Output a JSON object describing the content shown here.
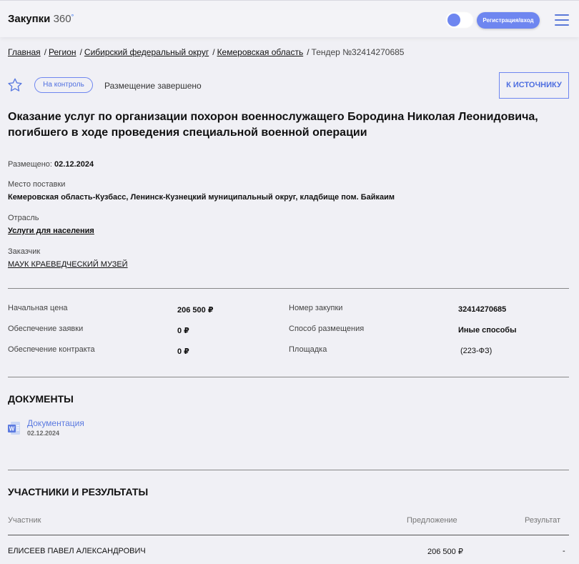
{
  "header": {
    "logo_text": "Закупки",
    "logo_num": "360",
    "logo_sup": "°",
    "register_label": "Регистрация/вход"
  },
  "breadcrumb": {
    "items": [
      "Главная",
      "Регион",
      "Сибирский федеральный округ",
      "Кемеровская область"
    ],
    "current": "Тендер №32414270685"
  },
  "actions": {
    "control_label": "На контроль",
    "status": "Размещение завершено",
    "source_label": "К ИСТОЧНИКУ"
  },
  "tender": {
    "title": "Оказание услуг по организации похорон военнослужащего Бородина Николая Леонидовича, погибшего в ходе проведения специальной военной операции",
    "posted_label": "Размещено:",
    "posted_value": "02.12.2024",
    "delivery_label": "Место поставки",
    "delivery_value": "Кемеровская область-Кузбасс, Ленинск-Кузнецкий муниципальный округ, кладбище пом. Байкаим",
    "industry_label": "Отрасль",
    "industry_value": "Услуги для населения",
    "customer_label": "Заказчик",
    "customer_value": "МАУК КРАЕВЕДЧЕСКИЙ МУЗЕЙ"
  },
  "details": {
    "start_price_label": "Начальная цена",
    "start_price_value": "206 500 ₽",
    "bid_security_label": "Обеспечение заявки",
    "bid_security_value": "0 ₽",
    "contract_security_label": "Обеспечение контракта",
    "contract_security_value": "0 ₽",
    "purchase_no_label": "Номер закупки",
    "purchase_no_value": "32414270685",
    "method_label": "Способ размещения",
    "method_value": "Иные способы",
    "platform_label": "Площадка",
    "platform_value": "(223-ФЗ)"
  },
  "documents": {
    "title": "ДОКУМЕНТЫ",
    "items": [
      {
        "name": "Документация",
        "date": "02.12.2024"
      }
    ]
  },
  "participants": {
    "title": "УЧАСТНИКИ И РЕЗУЛЬТАТЫ",
    "columns": [
      "Участник",
      "Предложение",
      "Результат"
    ],
    "rows": [
      {
        "name": "ЕЛИСЕЕВ ПАВЕЛ АЛЕКСАНДРОВИЧ",
        "offer": "206 500 ₽",
        "result": "-"
      }
    ]
  },
  "colors": {
    "accent": "#6e86f0",
    "background": "#f0f0f5"
  }
}
